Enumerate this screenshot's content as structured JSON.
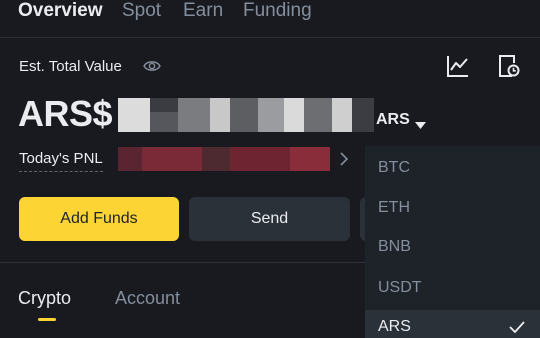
{
  "tabs": [
    "Overview",
    "Spot",
    "Earn",
    "Funding"
  ],
  "balance": {
    "est_label": "Est. Total Value",
    "currency_prefix": "ARS$",
    "pnl_label": "Today's PNL"
  },
  "buttons": {
    "add_funds": "Add Funds",
    "send": "Send"
  },
  "subtabs": [
    "Crypto",
    "Account"
  ],
  "currency_dropdown": {
    "selected": "ARS",
    "options": [
      "BTC",
      "ETH",
      "BNB",
      "USDT",
      "ARS"
    ]
  },
  "colors": {
    "accent": "#fcd535",
    "background": "#181a20",
    "muted": "#848e9c",
    "pnl_blur": "#7a2a36"
  },
  "icons": [
    "eye-icon",
    "chart-icon",
    "history-icon",
    "chevron-right-icon",
    "caret-down-icon",
    "check-icon"
  ]
}
